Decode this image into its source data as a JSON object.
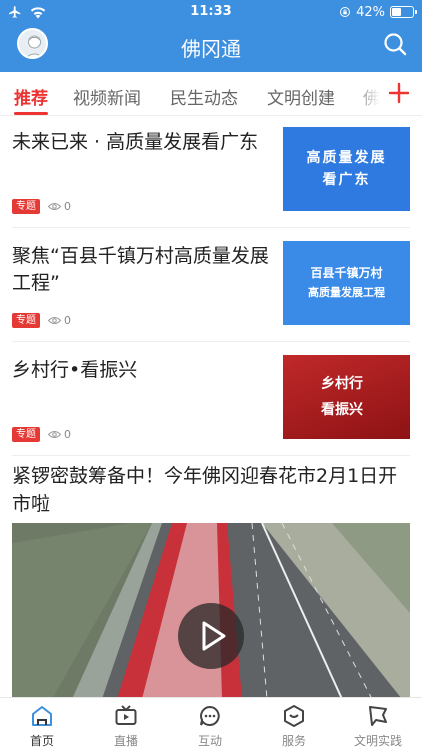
{
  "status_bar": {
    "time": "11:33",
    "battery": "42%"
  },
  "header": {
    "title": "佛冈通"
  },
  "tabs": [
    {
      "label": "推荐",
      "active": true
    },
    {
      "label": "视频新闻"
    },
    {
      "label": "民生动态"
    },
    {
      "label": "文明创建"
    },
    {
      "label": "佛"
    }
  ],
  "articles": [
    {
      "title": "未来已来 · 高质量发展看广东",
      "tag": "专题",
      "views": "0",
      "thumb_lines": [
        "高质量发展",
        "看广东"
      ]
    },
    {
      "title": "聚焦“百县千镇万村高质量发展工程”",
      "tag": "专题",
      "views": "0",
      "thumb_lines": [
        "百县千镇万村",
        "高质量发展工程"
      ]
    },
    {
      "title": "乡村行•看振兴",
      "tag": "专题",
      "views": "0",
      "thumb_lines": [
        "乡村行",
        "看振兴"
      ]
    }
  ],
  "video_article": {
    "title": "紧锣密鼓筹备中！今年佛冈迎春花市2月1日开市啦"
  },
  "bottom_nav": [
    {
      "label": "首页",
      "active": true
    },
    {
      "label": "直播"
    },
    {
      "label": "互动"
    },
    {
      "label": "服务"
    },
    {
      "label": "文明实践"
    }
  ],
  "colors": {
    "header_blue": "#3d8fe0",
    "accent_red": "#e33",
    "tag_red": "#e53935"
  }
}
